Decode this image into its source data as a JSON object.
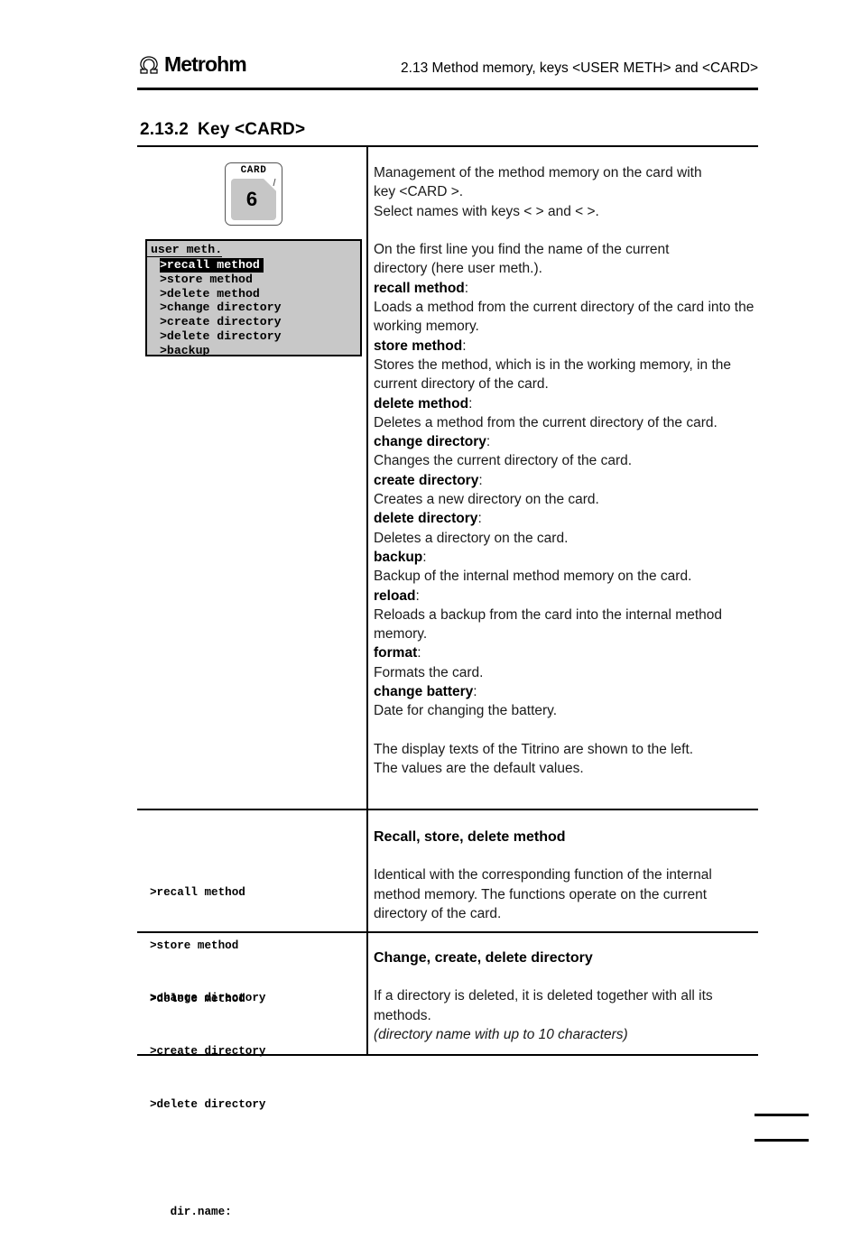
{
  "header": {
    "logo_text": "Metrohm",
    "logo_icon": "metrohm-omega-logo",
    "title": "2.13 Method memory, keys <USER METH> and <CARD>"
  },
  "section": {
    "number": "2.13.2",
    "title": "Key <CARD>"
  },
  "card_key": {
    "label": "CARD",
    "number": "6"
  },
  "display": {
    "title": "user meth.",
    "items": [
      ">recall method",
      ">store method",
      ">delete method",
      ">change directory",
      ">create directory",
      ">delete directory",
      ">backup"
    ],
    "selected_index": 0
  },
  "main_text": {
    "p1_line1": "Management of the method memory on the card with",
    "p1_line2": "key <CARD >.",
    "p1_line3": "Select names with keys <   > and <   >.",
    "p2_line1": "On the first line you find the name of the current",
    "p2_line2": "directory (here user meth.).",
    "entries": [
      {
        "term": "recall method",
        "colon": ":",
        "desc": "Loads a method from the current directory of the card into the working memory."
      },
      {
        "term": "store method",
        "colon": ":",
        "desc": "Stores the method, which is in the working memory, in the current directory of the card."
      },
      {
        "term": "delete method",
        "colon": ":",
        "desc": "Deletes a method from the current directory of the card."
      },
      {
        "term": "change directory",
        "colon": ":",
        "desc": "Changes the current directory of the card."
      },
      {
        "term": "create directory",
        "colon": ":",
        "desc": "Creates a new directory on the card."
      },
      {
        "term": "delete directory",
        "colon": ":",
        "desc": "Deletes a directory on the card."
      },
      {
        "term": "backup",
        "colon": ":",
        "desc": "Backup of the internal method memory on the card."
      },
      {
        "term": "reload",
        "colon": ":",
        "desc": "Reloads a backup from the card into the internal method memory."
      },
      {
        "term": "format",
        "colon": ":",
        "desc": "Formats the card."
      },
      {
        "term": "change battery",
        "colon": ":",
        "desc": "Date for changing the battery."
      }
    ],
    "closing_line1": "The display texts of the Titrino are shown to the left.",
    "closing_line2": "The values are the default values."
  },
  "row_recall": {
    "mono_lines": [
      ">recall method",
      ">store method",
      ">delete method"
    ],
    "heading": "Recall, store, delete method",
    "body": "Identical with the corresponding function of the internal method memory. The functions operate on the current directory of the card."
  },
  "row_directory": {
    "mono_lines": [
      ">change directory",
      ">create directory",
      ">delete directory"
    ],
    "mono_field": "   dir.name:",
    "heading": "Change, create, delete directory",
    "body": "If a directory is deleted, it is deleted together with all its methods.",
    "note": "(directory name with up to 10 characters)"
  }
}
